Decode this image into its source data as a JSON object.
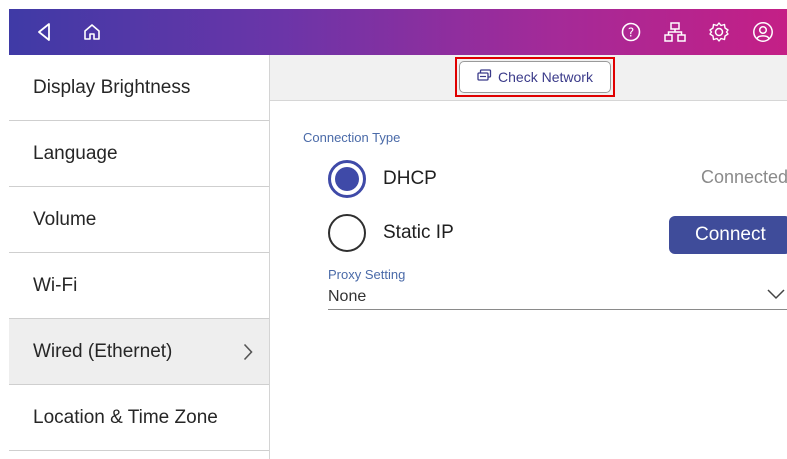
{
  "topbar": {
    "left_icons": [
      "back-icon",
      "home-icon"
    ],
    "right_icons": [
      "help-icon",
      "network-icon",
      "settings-icon",
      "account-icon"
    ],
    "gradient": [
      "#3f3aa6",
      "#c41f86"
    ]
  },
  "sidebar": {
    "items": [
      {
        "label": "Display Brightness"
      },
      {
        "label": "Language"
      },
      {
        "label": "Volume"
      },
      {
        "label": "Wi-Fi"
      },
      {
        "label": "Wired (Ethernet)",
        "active": true
      },
      {
        "label": "Location & Time Zone"
      }
    ]
  },
  "main": {
    "check_network_label": "Check Network",
    "connection_type_label": "Connection Type",
    "options": [
      {
        "label": "DHCP",
        "selected": true
      },
      {
        "label": "Static IP",
        "selected": false
      }
    ],
    "status": "Connected",
    "connect_label": "Connect",
    "proxy_label": "Proxy Setting",
    "proxy_value": "None"
  },
  "colors": {
    "accent": "#3f4aa8",
    "button": "#3f4c9a",
    "highlight": "#e00000"
  }
}
